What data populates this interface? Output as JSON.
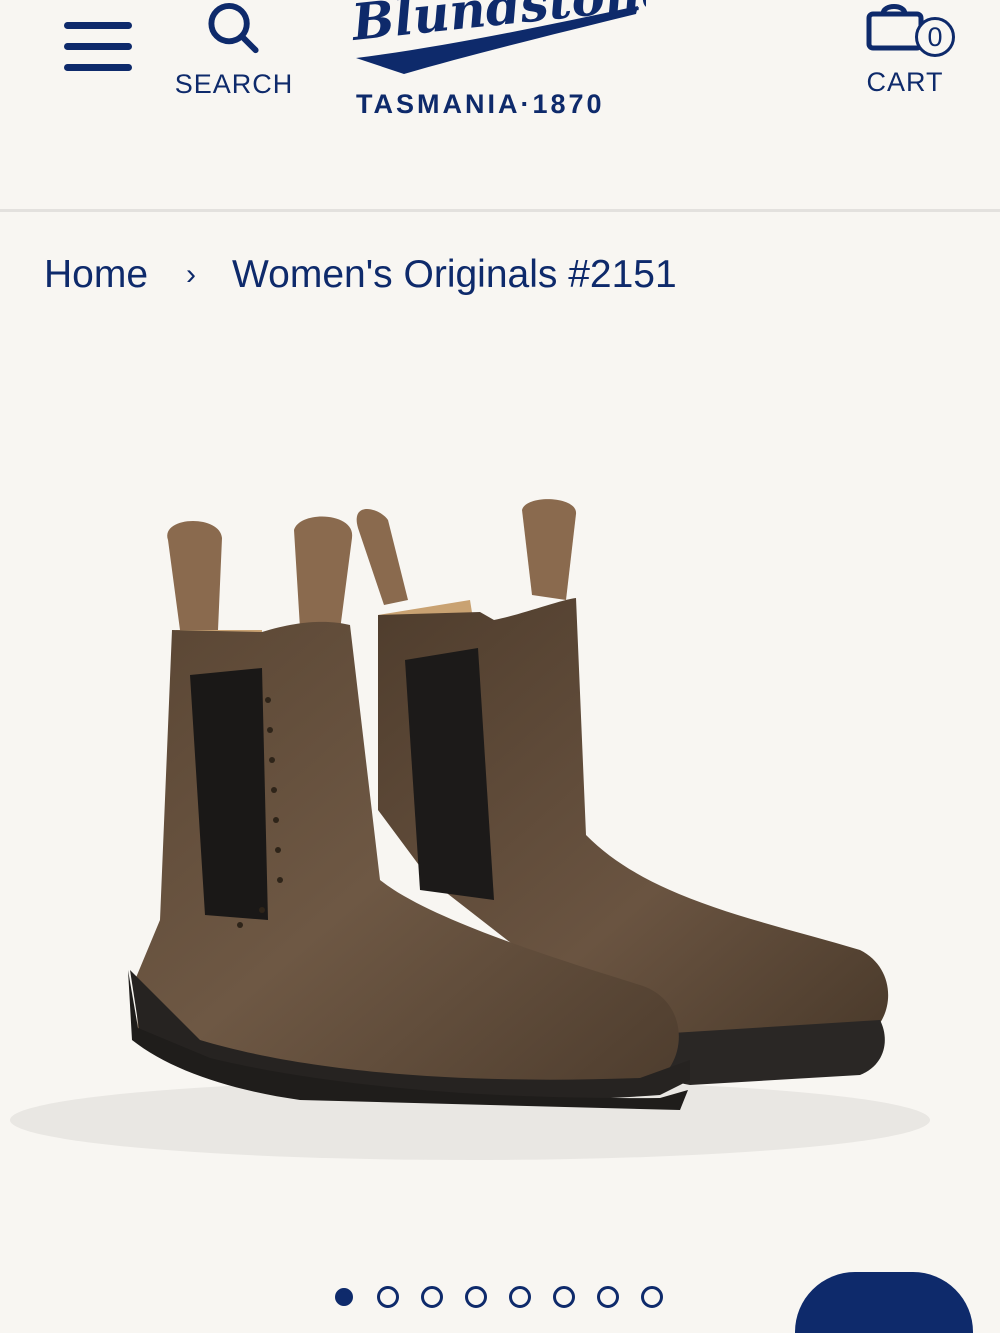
{
  "header": {
    "menu_icon": "hamburger-menu-icon",
    "search_label": "SEARCH",
    "search_icon": "search-icon",
    "logo_text": "Blundstone",
    "logo_tagline": "TASMANIA·1870",
    "cart_label": "CART",
    "cart_icon": "shopping-bag-icon",
    "cart_count": "0"
  },
  "breadcrumb": {
    "home": "Home",
    "separator": "›",
    "current": "Women's Originals #2151"
  },
  "product": {
    "image_subject": "pair of brown leather chelsea boots"
  },
  "carousel": {
    "total": 8,
    "active": 1
  },
  "colors": {
    "brand_navy": "#0e2a6b",
    "background": "#f8f6f2",
    "boot_brown": "#6b5440"
  }
}
